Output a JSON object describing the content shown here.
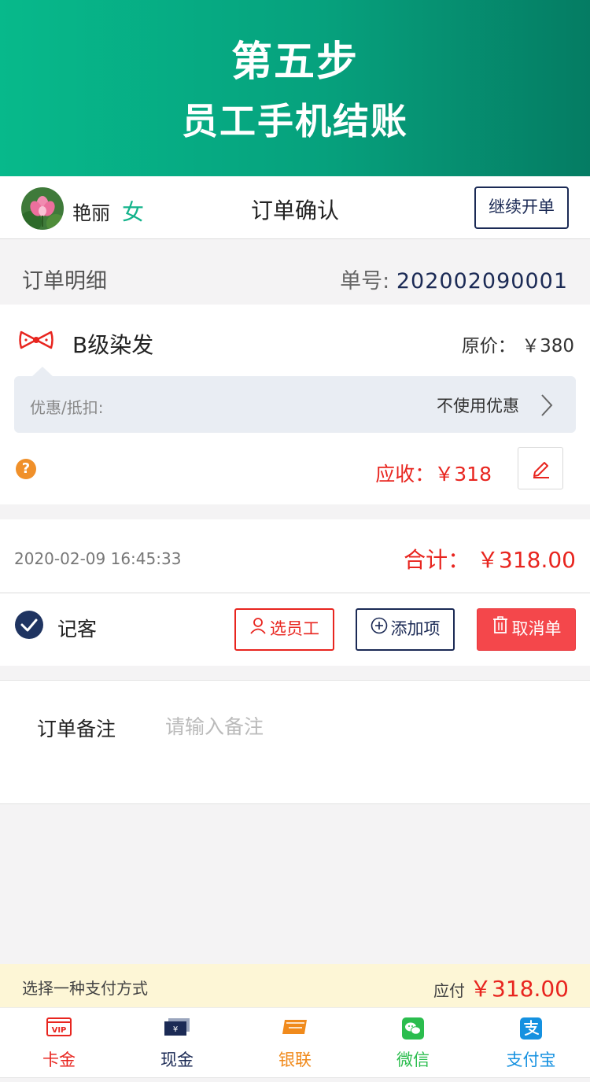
{
  "banner": {
    "line1": "第五步",
    "line2": "员工手机结账"
  },
  "header": {
    "user_name": "艳丽",
    "gender": "女",
    "title": "订单确认",
    "continue_label": "继续开单"
  },
  "order_detail": {
    "label": "订单明细",
    "number_label": "单号:",
    "number_value": "202002090001"
  },
  "item": {
    "name": "B级染发",
    "original_price": "原价： ￥380",
    "discount_label": "优惠/抵扣:",
    "discount_value": "不使用优惠",
    "receivable": "应收：￥318"
  },
  "summary": {
    "datetime": "2020-02-09 16:45:33",
    "total": "合计： ￥318.00",
    "register_customer": "记客",
    "select_staff": "选员工",
    "add_item": "添加项",
    "cancel_order": "取消单"
  },
  "note": {
    "label": "订单备注",
    "placeholder": "请输入备注"
  },
  "payment": {
    "prompt": "选择一种支付方式",
    "due_label": "应付",
    "due_amount": "￥318.00",
    "methods": [
      {
        "label": "卡金",
        "icon": "vip-card-icon",
        "color": "#e8251f"
      },
      {
        "label": "现金",
        "icon": "cash-icon",
        "color": "#1b2a55"
      },
      {
        "label": "银联",
        "icon": "unionpay-icon",
        "color": "#f08a1c"
      },
      {
        "label": "微信",
        "icon": "wechat-icon",
        "color": "#2bbd4e"
      },
      {
        "label": "支付宝",
        "icon": "alipay-icon",
        "color": "#1591e0"
      }
    ]
  },
  "colors": {
    "accent_green": "#07b98b",
    "price_red": "#e8251f",
    "navy": "#1b2a55"
  }
}
